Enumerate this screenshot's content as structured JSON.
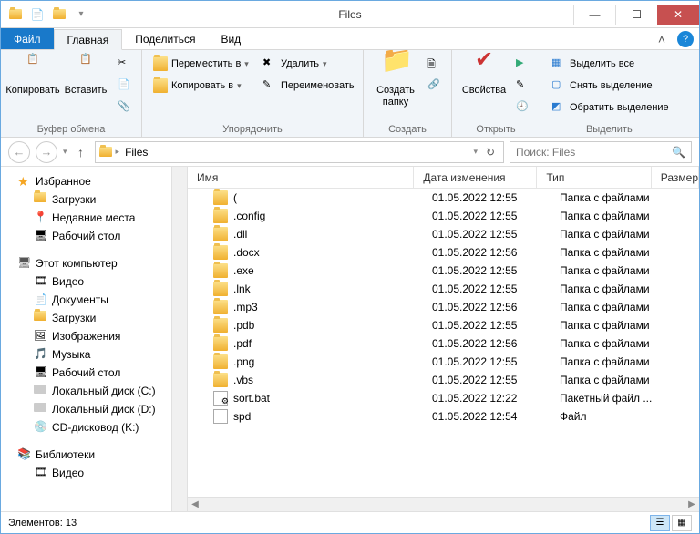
{
  "window": {
    "title": "Files"
  },
  "tabs": {
    "file": "Файл",
    "home": "Главная",
    "share": "Поделиться",
    "view": "Вид"
  },
  "ribbon": {
    "clipboard": {
      "label": "Буфер обмена",
      "copy": "Копировать",
      "paste": "Вставить"
    },
    "organize": {
      "label": "Упорядочить",
      "move": "Переместить в",
      "copyto": "Копировать в",
      "delete": "Удалить",
      "rename": "Переименовать"
    },
    "new": {
      "label": "Создать",
      "newfolder1": "Создать",
      "newfolder2": "папку"
    },
    "open": {
      "label": "Открыть",
      "props": "Свойства"
    },
    "select": {
      "label": "Выделить",
      "all": "Выделить все",
      "none": "Снять выделение",
      "invert": "Обратить выделение"
    }
  },
  "address": {
    "path": "Files",
    "search_placeholder": "Поиск: Files"
  },
  "columns": {
    "name": "Имя",
    "modified": "Дата изменения",
    "type": "Тип",
    "size": "Размер"
  },
  "sidebar": {
    "favorites": "Избранное",
    "favorites_items": [
      "Загрузки",
      "Недавние места",
      "Рабочий стол"
    ],
    "thispc": "Этот компьютер",
    "thispc_items": [
      "Видео",
      "Документы",
      "Загрузки",
      "Изображения",
      "Музыка",
      "Рабочий стол",
      "Локальный диск (C:)",
      "Локальный диск (D:)",
      "CD-дисковод (K:)"
    ],
    "libraries": "Библиотеки",
    "libraries_items": [
      "Видео"
    ]
  },
  "rows": [
    {
      "name": "(",
      "date": "01.05.2022 12:55",
      "type": "Папка с файлами",
      "kind": "folder"
    },
    {
      "name": ".config",
      "date": "01.05.2022 12:55",
      "type": "Папка с файлами",
      "kind": "folder"
    },
    {
      "name": ".dll",
      "date": "01.05.2022 12:55",
      "type": "Папка с файлами",
      "kind": "folder"
    },
    {
      "name": ".docx",
      "date": "01.05.2022 12:56",
      "type": "Папка с файлами",
      "kind": "folder"
    },
    {
      "name": ".exe",
      "date": "01.05.2022 12:55",
      "type": "Папка с файлами",
      "kind": "folder"
    },
    {
      "name": ".lnk",
      "date": "01.05.2022 12:55",
      "type": "Папка с файлами",
      "kind": "folder"
    },
    {
      "name": ".mp3",
      "date": "01.05.2022 12:56",
      "type": "Папка с файлами",
      "kind": "folder"
    },
    {
      "name": ".pdb",
      "date": "01.05.2022 12:55",
      "type": "Папка с файлами",
      "kind": "folder"
    },
    {
      "name": ".pdf",
      "date": "01.05.2022 12:56",
      "type": "Папка с файлами",
      "kind": "folder"
    },
    {
      "name": ".png",
      "date": "01.05.2022 12:55",
      "type": "Папка с файлами",
      "kind": "folder"
    },
    {
      "name": ".vbs",
      "date": "01.05.2022 12:55",
      "type": "Папка с файлами",
      "kind": "folder"
    },
    {
      "name": "sort.bat",
      "date": "01.05.2022 12:22",
      "type": "Пакетный файл ...",
      "kind": "bat"
    },
    {
      "name": "spd",
      "date": "01.05.2022 12:54",
      "type": "Файл",
      "kind": "file"
    }
  ],
  "status": {
    "count": "Элементов: 13"
  }
}
